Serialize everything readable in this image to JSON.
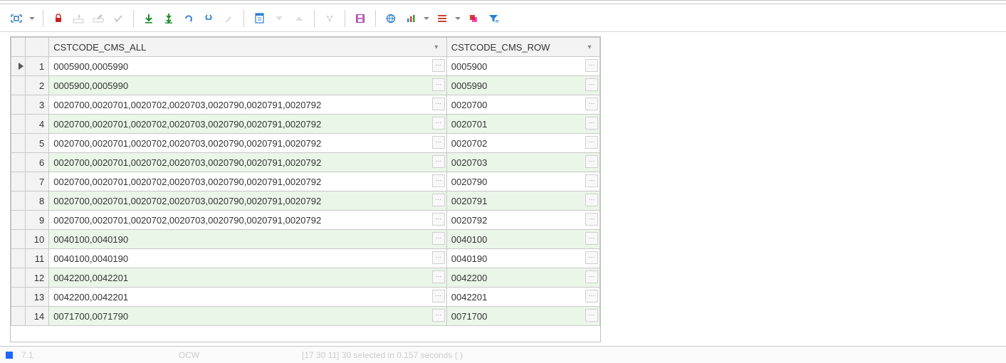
{
  "toolbar": {
    "icons": [
      "fit-grid",
      "dropdown",
      "sep",
      "lock",
      "edit-inline",
      "new-row",
      "commit",
      "sep",
      "fetch-down",
      "fetch-all",
      "refresh",
      "find",
      "clear",
      "sep",
      "export-xls",
      "sort-asc",
      "sort-desc",
      "sep",
      "link",
      "sep",
      "save",
      "sep",
      "globe",
      "chart",
      "dropdown",
      "list",
      "dropdown",
      "stack",
      "filter"
    ]
  },
  "columns": {
    "col1": "CSTCODE_CMS_ALL",
    "col2": "CSTCODE_CMS_ROW"
  },
  "rows": [
    {
      "n": "1",
      "all": "0005900,0005990",
      "row": "0005900",
      "current": true
    },
    {
      "n": "2",
      "all": "0005900,0005990",
      "row": "0005990"
    },
    {
      "n": "3",
      "all": "0020700,0020701,0020702,0020703,0020790,0020791,0020792",
      "row": "0020700"
    },
    {
      "n": "4",
      "all": "0020700,0020701,0020702,0020703,0020790,0020791,0020792",
      "row": "0020701"
    },
    {
      "n": "5",
      "all": "0020700,0020701,0020702,0020703,0020790,0020791,0020792",
      "row": "0020702"
    },
    {
      "n": "6",
      "all": "0020700,0020701,0020702,0020703,0020790,0020791,0020792",
      "row": "0020703"
    },
    {
      "n": "7",
      "all": "0020700,0020701,0020702,0020703,0020790,0020791,0020792",
      "row": "0020790"
    },
    {
      "n": "8",
      "all": "0020700,0020701,0020702,0020703,0020790,0020791,0020792",
      "row": "0020791"
    },
    {
      "n": "9",
      "all": "0020700,0020701,0020702,0020703,0020790,0020791,0020792",
      "row": "0020792"
    },
    {
      "n": "10",
      "all": "0040100,0040190",
      "row": "0040100"
    },
    {
      "n": "11",
      "all": "0040100,0040190",
      "row": "0040190"
    },
    {
      "n": "12",
      "all": "0042200,0042201",
      "row": "0042200"
    },
    {
      "n": "13",
      "all": "0042200,0042201",
      "row": "0042201"
    },
    {
      "n": "14",
      "all": "0071700,0071790",
      "row": "0071700"
    }
  ],
  "ellipsis": "···",
  "dd_glyph": "▾",
  "status": {
    "left1": "7.1",
    "mid": "OCW",
    "right": "[17 30 11]  30               selected in 0.157 seconds (         )"
  }
}
